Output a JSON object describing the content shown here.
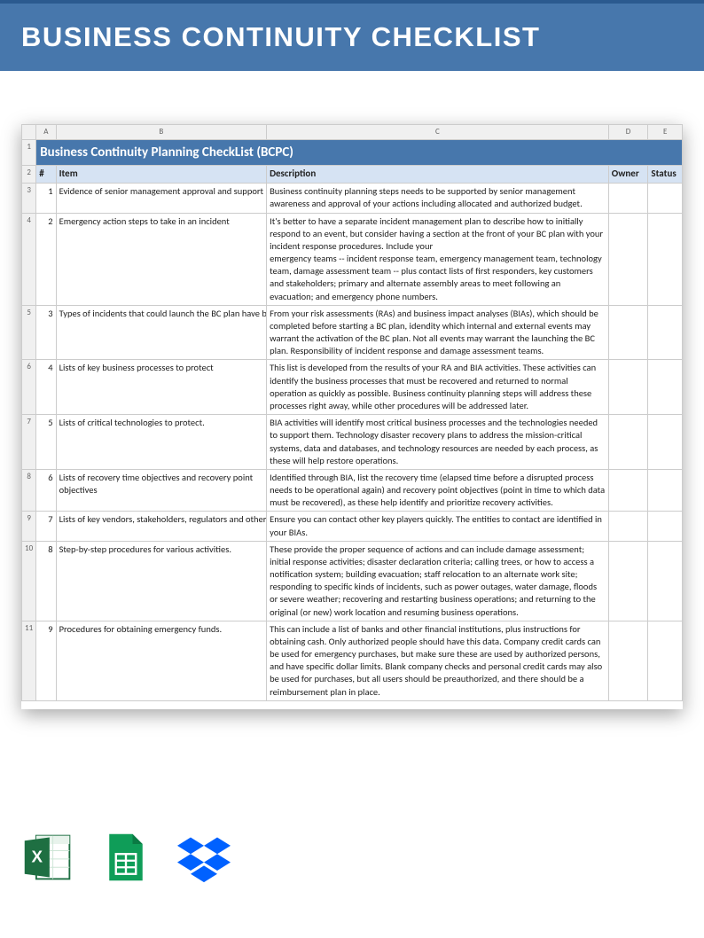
{
  "banner": {
    "title": "BUSINESS CONTINUITY CHECKLIST"
  },
  "sheet": {
    "title": "Business Continuity Planning CheckList (BCPC)",
    "col_letters": [
      "",
      "A",
      "B",
      "C",
      "D",
      "E"
    ],
    "headers": {
      "num": "#",
      "item": "Item",
      "desc": "Description",
      "owner": "Owner",
      "status": "Status"
    },
    "row_gutters": [
      "1",
      "2",
      "3",
      "4",
      "5",
      "6",
      "7",
      "8",
      "9",
      "10",
      "11"
    ],
    "rows": [
      {
        "n": "1",
        "item": "Evidence of senior management approval and support",
        "desc": "Business continuity planning steps  needs to be supported by senior management awareness and approval of your actions including allocated and authorized budget."
      },
      {
        "n": "2",
        "item": "Emergency action steps to take in an incident",
        "desc": "It's better to have a separate incident management plan to describe how to initially respond to an event, but consider having a section at the front of your BC plan with your incident response procedures. Include your\nemergency teams -- incident response team, emergency management team, technology team, damage assessment team -- plus contact lists of first responders, key customers and stakeholders; primary and alternate assembly areas to meet following an evacuation; and emergency phone numbers."
      },
      {
        "n": "3",
        "item": "Types of incidents that could launch the BC plan have been clearly de",
        "desc": "From your risk assessments (RAs) and business impact analyses (BIAs), which should be completed before starting a BC plan, idendity which internal and external events may warrant the activation of the BC plan. Not all events may warrant the launching the BC plan. Responsibility of incident response and damage assessment teams."
      },
      {
        "n": "4",
        "item": "Lists of key business processes to protect",
        "desc": "This list is developed from the results of your RA and BIA activities. These activities can identify the business processes that must be recovered and returned to normal operation as quickly as possible. Business continuity planning steps will  address these processes right away, while other procedures will be addressed later."
      },
      {
        "n": "5",
        "item": "Lists of critical technologies to protect.",
        "desc": "BIA activities will identify most critical business processes and the technologies needed to support them. Technology disaster recovery plans to address the mission-critical systems, data and databases, and technology resources are needed by each process, as these will help restore operations."
      },
      {
        "n": "6",
        "item": "Lists of recovery time objectives and recovery point objectives",
        "desc": "Identified through BIA, list the recovery time (elapsed time before a disrupted process needs to be operational again) and recovery point objectives (point in time to which data must be recovered), as these help identify and prioritize recovery activities."
      },
      {
        "n": "7",
        "item": "Lists of key vendors, stakeholders, regulators and other third parties.",
        "desc": "Ensure you can contact other key players quickly. The entities to contact are identified in your BIAs."
      },
      {
        "n": "8",
        "item": "Step-by-step procedures for various activities.",
        "desc": "These provide the proper sequence of actions and can include damage assessment; initial response activities; disaster declaration criteria; calling trees, or how to access a notification system; building evacuation; staff relocation to an alternate work site; responding to specific kinds of incidents, such as power outages, water damage, floods or severe weather; recovering and restarting business operations; and returning to the original (or new) work location and resuming business operations."
      },
      {
        "n": "9",
        "item": "Procedures for obtaining emergency funds.",
        "desc": "This can include a list of banks and other financial institutions, plus instructions for obtaining cash. Only authorized people should have this data. Company credit cards can be used for emergency purchases, but make sure these are used by authorized persons, and have specific dollar limits. Blank company checks and personal credit cards may also be used for purchases, but all users should be preauthorized, and there should be a reimbursement plan in place."
      }
    ]
  },
  "icons": {
    "excel": "excel-icon",
    "sheets": "google-sheets-icon",
    "dropbox": "dropbox-icon"
  }
}
